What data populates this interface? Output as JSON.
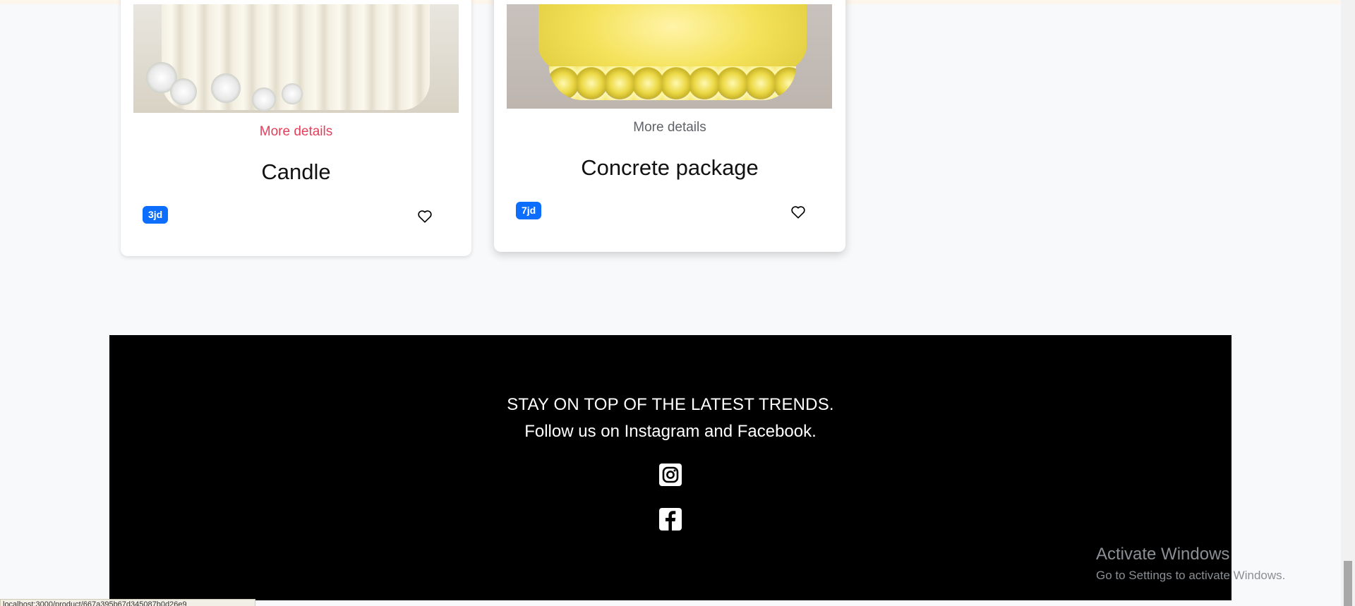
{
  "products": [
    {
      "more_label": "More details",
      "title": "Candle",
      "price": "3jd",
      "image_icon": "candle-photo"
    },
    {
      "more_label": "More details",
      "title": "Concrete package",
      "price": "7jd",
      "image_icon": "yellow-concrete-dish-photo"
    }
  ],
  "footer": {
    "line1": "STAY ON TOP OF THE LATEST TRENDS.",
    "line2": "Follow us on Instagram and Facebook.",
    "icons": [
      "instagram-icon",
      "facebook-icon"
    ]
  },
  "watermark": {
    "title": "Activate Windows",
    "subtitle": "Go to Settings to activate Windows."
  },
  "status_url": "localhost:3000/product/667a395b67d345087b0d26e9",
  "colors": {
    "link_active": "#e23f5b",
    "link_default": "#5f6368",
    "price_badge": "#0d6efd",
    "footer_bg": "#000000"
  }
}
